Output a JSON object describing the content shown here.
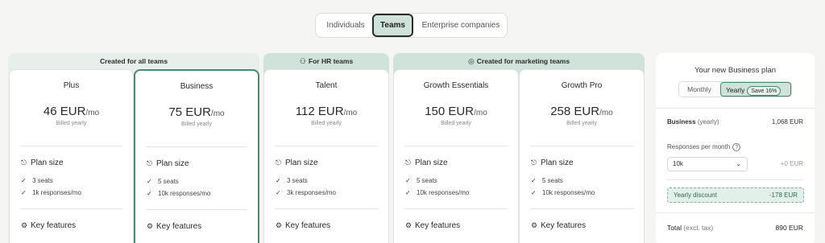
{
  "tabs": {
    "individuals": "Individuals",
    "teams": "Teams",
    "enterprise": "Enterprise companies",
    "selected": "Teams"
  },
  "groups": [
    {
      "label": "Created for all teams",
      "icon": ""
    },
    {
      "label": "For HR teams",
      "icon": "people-icon"
    },
    {
      "label": "Created for marketing teams",
      "icon": "target-icon"
    }
  ],
  "plans": [
    {
      "name": "Plus",
      "price": "46 EUR",
      "unit": "/mo",
      "billing": "Billed yearly",
      "seats": "3 seats",
      "responses": "1k responses/mo"
    },
    {
      "name": "Business",
      "price": "75 EUR",
      "unit": "/mo",
      "billing": "Billed yearly",
      "seats": "5 seats",
      "responses": "10k responses/mo",
      "selected": true
    },
    {
      "name": "Talent",
      "price": "112 EUR",
      "unit": "/mo",
      "billing": "Billed yearly",
      "seats": "3 seats",
      "responses": "3k responses/mo"
    },
    {
      "name": "Growth Essentials",
      "price": "150 EUR",
      "unit": "/mo",
      "billing": "Billed yearly",
      "seats": "5 seats",
      "responses": "10k responses/mo"
    },
    {
      "name": "Growth Pro",
      "price": "258 EUR",
      "unit": "/mo",
      "billing": "Billed yearly",
      "seats": "5 seats",
      "responses": "10k responses/mo"
    }
  ],
  "sections": {
    "plan_size": "Plan size",
    "key_features": "Key features"
  },
  "summary": {
    "title": "Your new Business plan",
    "monthly": "Monthly",
    "yearly": "Yearly",
    "save_badge": "Save 16%",
    "business_name": "Business",
    "business_period": "(yearly)",
    "business_price": "1,068 EUR",
    "responses_label": "Responses per month",
    "responses_value": "10k",
    "responses_price": "+0 EUR",
    "discount_label": "Yearly discount",
    "discount_value": "-178 EUR",
    "total_label": "Total",
    "total_excl": "(excl. tax)",
    "total_value": "890 EUR"
  },
  "colors": {
    "accent": "#cfe3da",
    "accent_border": "#4a8a71",
    "background": "#f5f5f3"
  }
}
